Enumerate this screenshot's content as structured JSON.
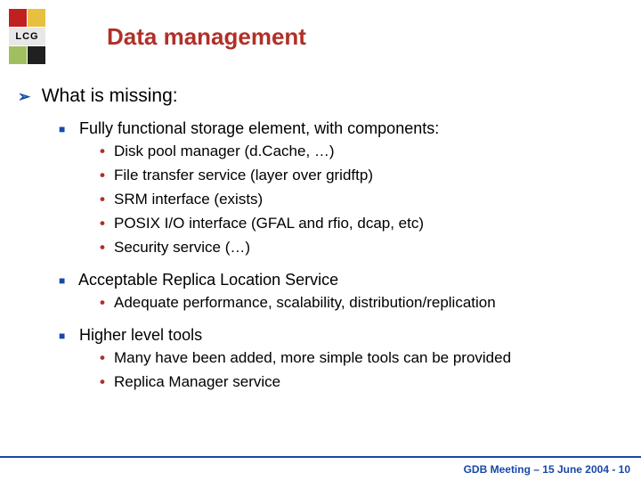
{
  "logo_label": "LCG",
  "title": "Data management",
  "heading": "What is missing:",
  "sections": [
    {
      "label": "Fully functional storage element, with components:",
      "items": [
        "Disk pool manager  (d.Cache, …)",
        "File transfer service (layer over gridftp)",
        "SRM interface  (exists)",
        "POSIX I/O interface  (GFAL and rfio, dcap, etc)",
        "Security service (…)"
      ]
    },
    {
      "label": "Acceptable Replica Location Service",
      "items": [
        "Adequate performance, scalability, distribution/replication"
      ]
    },
    {
      "label": "Higher level tools",
      "items": [
        "Many have been added, more simple tools can be provided",
        "Replica Manager service"
      ]
    }
  ],
  "footer": "GDB Meeting – 15 June 2004  - 10"
}
